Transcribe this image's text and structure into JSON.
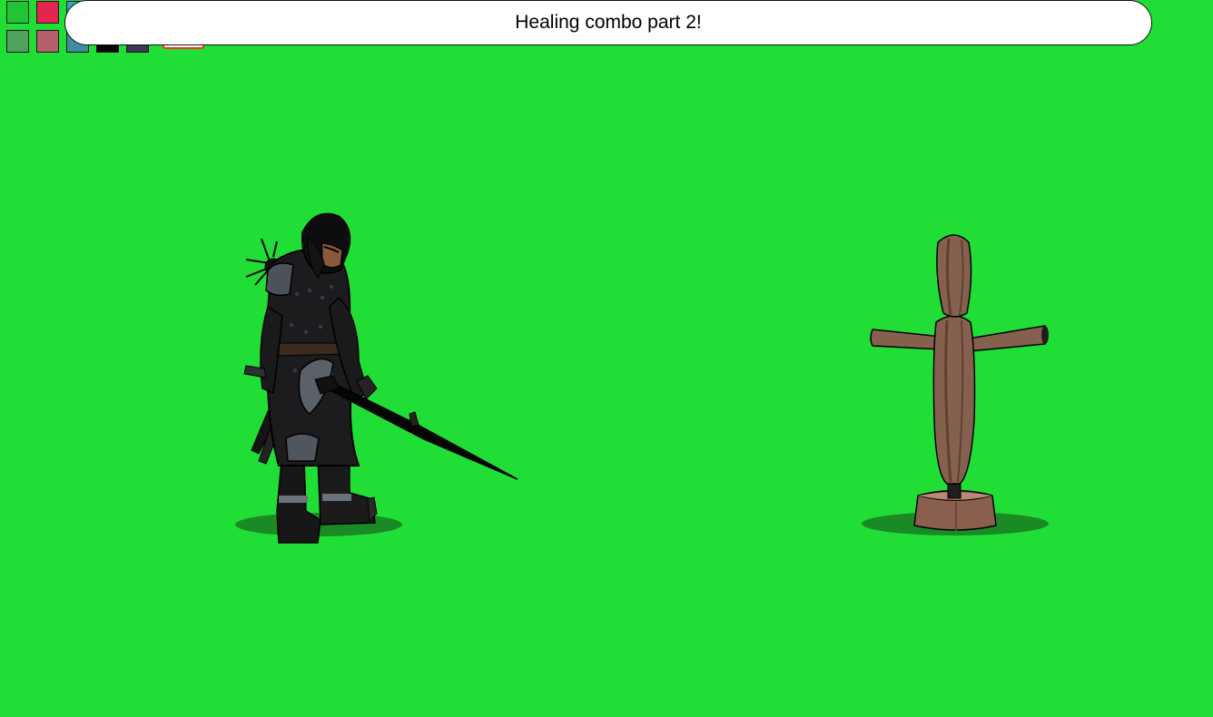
{
  "scene": {
    "background_color": "#20de36",
    "shadow_color": "#1a8a25"
  },
  "message": {
    "text": "Healing combo part 2!"
  },
  "palette": {
    "swatches": [
      {
        "name": "swatch-green",
        "color": "#22c436"
      },
      {
        "name": "swatch-crimson",
        "color": "#e3254f"
      },
      {
        "name": "swatch-teal",
        "color": "#28a7c7"
      },
      {
        "name": "swatch-sage",
        "color": "#4ea25e"
      },
      {
        "name": "swatch-rose",
        "color": "#b75e6c"
      },
      {
        "name": "swatch-steel-blue",
        "color": "#3f8da1"
      },
      {
        "name": "swatch-black",
        "color": "#050308"
      },
      {
        "name": "swatch-slate-purple",
        "color": "#3a3856"
      }
    ],
    "marker_color": "#ff2b2b"
  },
  "characters": {
    "player": {
      "icon": "armored-knight-icon"
    },
    "target": {
      "icon": "training-dummy-icon"
    }
  }
}
